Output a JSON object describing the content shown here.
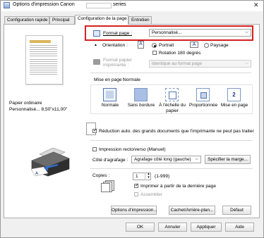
{
  "window": {
    "title": "Options d'impression Canon",
    "title_suffix": "series"
  },
  "tabs": [
    "Configuration rapide",
    "Principal",
    "Configuration de la page",
    "Entretien"
  ],
  "preview": {
    "media_type": "Papier ordinaire",
    "paper_size": "Personnalisé... 8,50\"x11,00\""
  },
  "page_size": {
    "label": "Format page :",
    "value": "Personnalisé..."
  },
  "orientation": {
    "label": "Orientation :",
    "portrait": "Portrait",
    "landscape": "Paysage",
    "rotate_180": "Rotation 180 degrés"
  },
  "printer_paper": {
    "label_line1": "Format papier",
    "label_line2": "imprimante :",
    "value": "Identique au format page"
  },
  "page_layout": {
    "label": "Mise en page :",
    "value": "Normale",
    "options": [
      "Normale",
      "Sans bordure",
      "À l'échelle du papier",
      "Proportionnée",
      "Mise en page"
    ],
    "mise_en_page_number": "2"
  },
  "auto_reduce": {
    "label": "Réduction auto. des grands documents que l'imprimante ne peut pas traiter",
    "checked": true
  },
  "duplex": {
    "label": "Impression recto/verso (Manuel)",
    "checked": false
  },
  "stapling": {
    "label": "Côté d'agrafage :",
    "value": "Agrafage côté long (gauche)",
    "button": "Spécifier la marge..."
  },
  "copies": {
    "label": "Copies :",
    "value": "1",
    "range": "(1-999)",
    "print_last_page": "Imprimer à partir de la dernière page",
    "collate": "Assembler"
  },
  "bottom_buttons": {
    "print_options": "Options d'impression...",
    "stamp_background": "Cachet/Arrière-plan...",
    "defaults": "Défaut"
  },
  "dialog_buttons": {
    "ok": "OK",
    "cancel": "Annuler",
    "apply": "Appliquer",
    "help": "Aide"
  }
}
